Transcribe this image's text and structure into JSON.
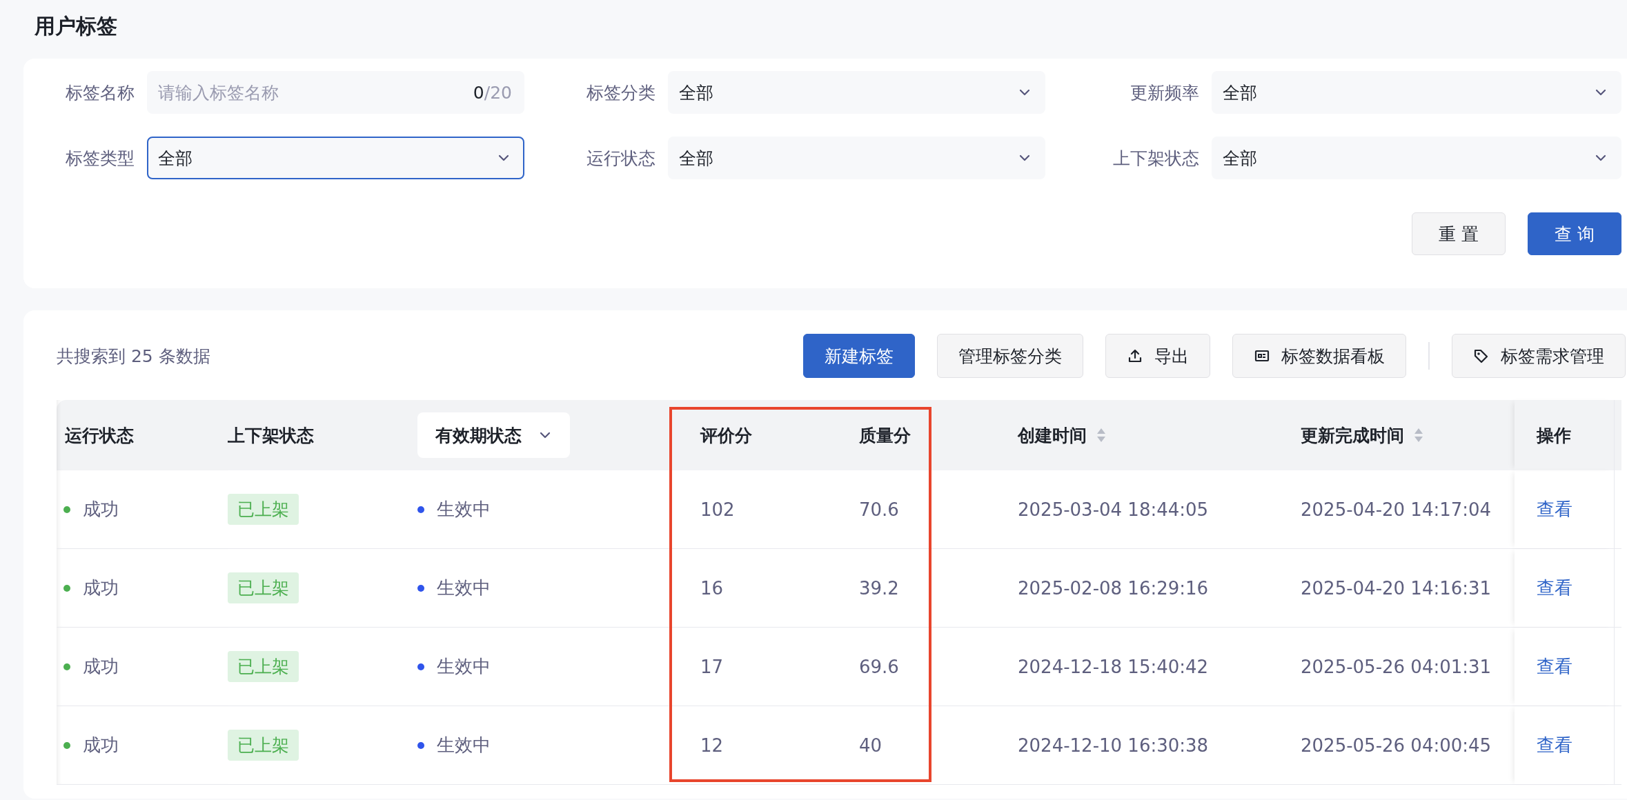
{
  "page_title": "用户标签",
  "filters": [
    {
      "kind": "text",
      "label": "标签名称",
      "placeholder": "请输入标签名称",
      "count": "0",
      "limit": "/20",
      "focused": false
    },
    {
      "kind": "select",
      "label": "标签分类",
      "value": "全部",
      "focused": false
    },
    {
      "kind": "select",
      "label": "更新频率",
      "value": "全部",
      "focused": false
    },
    {
      "kind": "select",
      "label": "标签类型",
      "value": "全部",
      "focused": true
    },
    {
      "kind": "select",
      "label": "运行状态",
      "value": "全部",
      "focused": false
    },
    {
      "kind": "select",
      "label": "上下架状态",
      "value": "全部",
      "focused": false
    }
  ],
  "filter_buttons": [
    {
      "label": "重 置",
      "kind": "default"
    },
    {
      "label": "查 询",
      "kind": "primary"
    }
  ],
  "result_count": "共搜索到 25 条数据",
  "toolbar_buttons": [
    {
      "label": "新建标签",
      "kind": "primary"
    },
    {
      "label": "管理标签分类",
      "kind": "default"
    },
    {
      "label": "导出",
      "kind": "default"
    },
    {
      "label": "标签数据看板",
      "kind": "default"
    },
    {
      "label": "标签需求管理",
      "kind": "default"
    }
  ],
  "table": {
    "highlight_frame": {
      "shown": true
    },
    "columns": [
      {
        "label": "运行状态",
        "kind": "plain"
      },
      {
        "label": "上下架状态",
        "kind": "plain"
      },
      {
        "label": "有效期状态",
        "kind": "filter"
      },
      {
        "label": "评价分",
        "kind": "plain"
      },
      {
        "label": "质量分",
        "kind": "plain"
      },
      {
        "label": "创建时间",
        "kind": "sortable"
      },
      {
        "label": "更新完成时间",
        "kind": "sortable"
      },
      {
        "label": "操作",
        "kind": "plain"
      }
    ],
    "rows": [
      {
        "run_status": {
          "text": "成功",
          "color": "#4caf50"
        },
        "shelf_status": "已上架",
        "validity": {
          "text": "生效中",
          "color": "#2f54eb"
        },
        "rating": "102",
        "quality": "70.6",
        "created": "2025-03-04 18:44:05",
        "updated": "2025-04-20 14:17:04",
        "action": "查看"
      },
      {
        "run_status": {
          "text": "成功",
          "color": "#4caf50"
        },
        "shelf_status": "已上架",
        "validity": {
          "text": "生效中",
          "color": "#2f54eb"
        },
        "rating": "16",
        "quality": "39.2",
        "created": "2025-02-08 16:29:16",
        "updated": "2025-04-20 14:16:31",
        "action": "查看"
      },
      {
        "run_status": {
          "text": "成功",
          "color": "#4caf50"
        },
        "shelf_status": "已上架",
        "validity": {
          "text": "生效中",
          "color": "#2f54eb"
        },
        "rating": "17",
        "quality": "69.6",
        "created": "2024-12-18 15:40:42",
        "updated": "2025-05-26 04:01:31",
        "action": "查看"
      },
      {
        "run_status": {
          "text": "成功",
          "color": "#4caf50"
        },
        "shelf_status": "已上架",
        "validity": {
          "text": "生效中",
          "color": "#2f54eb"
        },
        "rating": "12",
        "quality": "40",
        "created": "2024-12-10 16:30:38",
        "updated": "2025-05-26 04:00:45",
        "action": "查看"
      }
    ]
  }
}
